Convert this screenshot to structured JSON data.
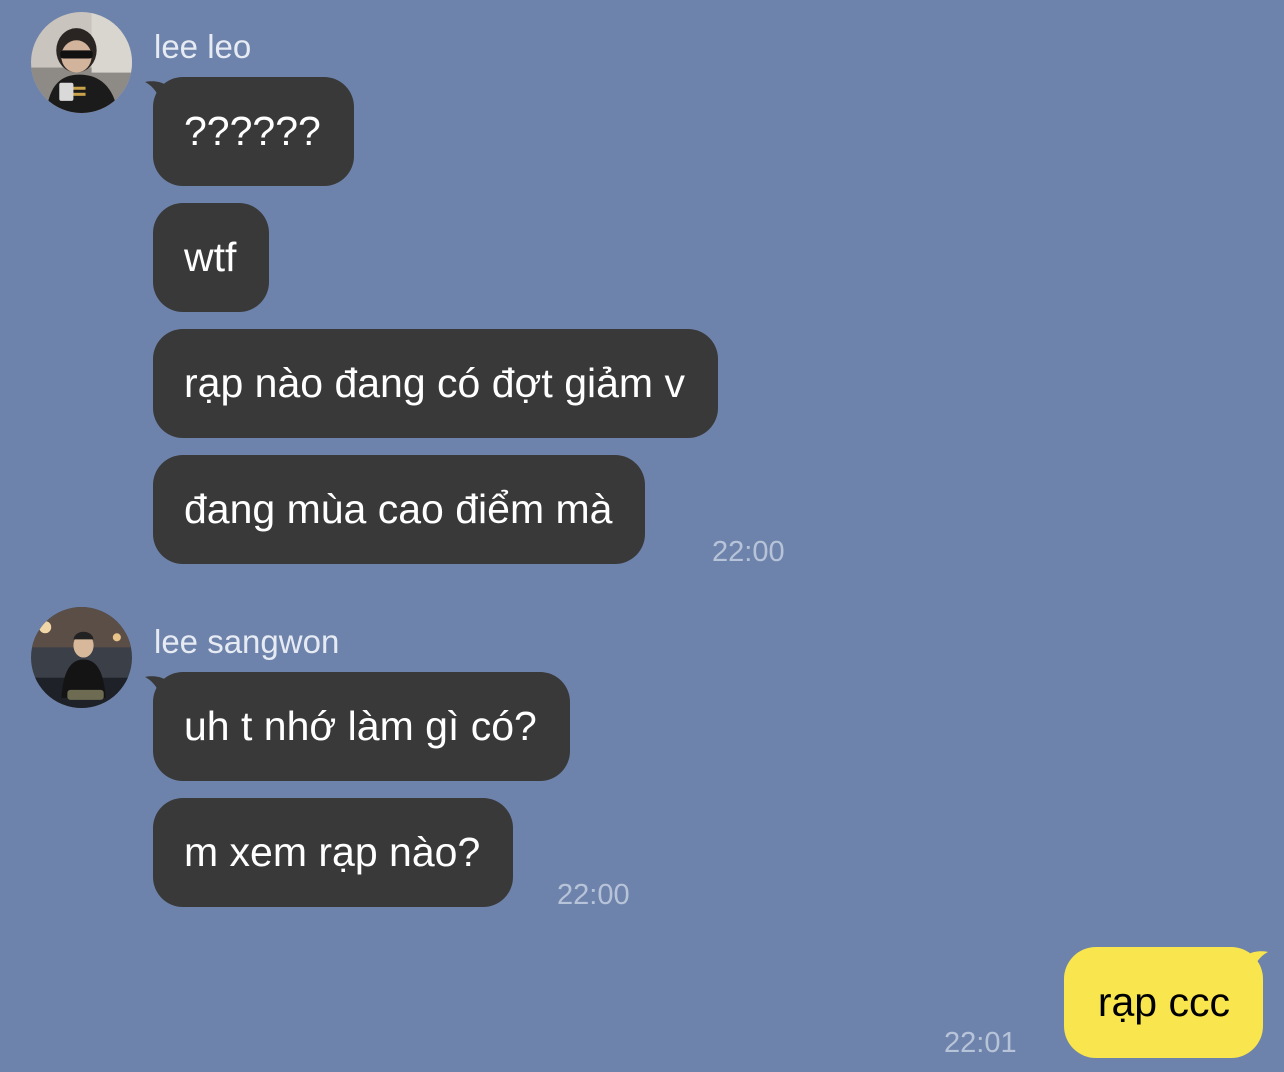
{
  "groups": [
    {
      "sender": "lee leo",
      "messages": [
        "??????",
        "wtf",
        "rạp nào đang có đợt giảm v",
        "đang mùa cao điểm mà"
      ],
      "time": "22:00"
    },
    {
      "sender": "lee sangwon",
      "messages": [
        "uh t nhớ làm gì có?",
        "m xem rạp nào?"
      ],
      "time": "22:00"
    }
  ],
  "mine": {
    "message": "rạp ccc",
    "time": "22:01"
  },
  "colors": {
    "background": "#6e83ab",
    "incoming_bubble": "#393939",
    "outgoing_bubble": "#f9e54d"
  }
}
